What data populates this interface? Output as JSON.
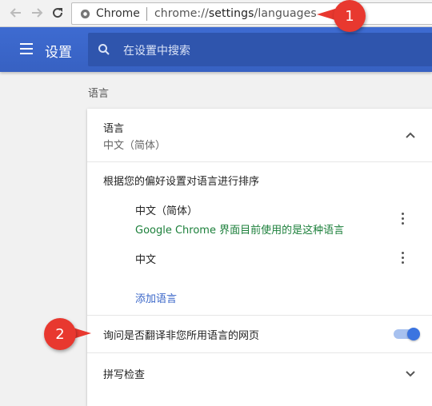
{
  "browser": {
    "omnibox": {
      "scheme_label": "Chrome",
      "url_prefix": "chrome://",
      "url_host": "settings",
      "url_path": "/languages"
    }
  },
  "callouts": [
    {
      "label": "1"
    },
    {
      "label": "2"
    }
  ],
  "settings": {
    "title": "设置",
    "search_placeholder": "在设置中搜索"
  },
  "section": {
    "heading": "语言"
  },
  "languages_card": {
    "language_row": {
      "title": "语言",
      "value": "中文（简体）"
    },
    "order_label": "根据您的偏好设置对语言进行排序",
    "items": [
      {
        "name": "中文（简体）",
        "note": "Google Chrome 界面目前使用的是这种语言"
      },
      {
        "name": "中文",
        "note": ""
      }
    ],
    "add_language_label": "添加语言",
    "translate_label": "询问是否翻译非您所用语言的网页",
    "translate_enabled": true,
    "spellcheck_label": "拼写检查"
  },
  "colors": {
    "accent": "#3b67c9",
    "callout": "#e8382f",
    "note_green": "#1b7f3a"
  }
}
